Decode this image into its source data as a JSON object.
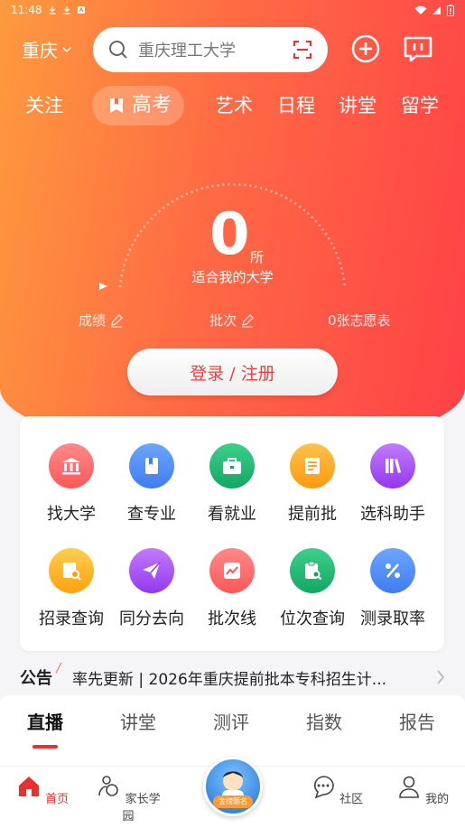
{
  "status": {
    "time": "11:48",
    "battery_icon": "battery-icon"
  },
  "header": {
    "city": "重庆",
    "search_placeholder": "重庆理工大学"
  },
  "tabs": [
    {
      "label": "关注"
    },
    {
      "label": "高考",
      "active": true
    },
    {
      "label": "艺术"
    },
    {
      "label": "日程"
    },
    {
      "label": "讲堂"
    },
    {
      "label": "留学"
    }
  ],
  "gauge": {
    "count": "0",
    "unit": "所",
    "label": "适合我的大学",
    "level": 0
  },
  "stats": {
    "score": "成绩",
    "batch": "批次",
    "wish": "0张志愿表"
  },
  "login_label": "登录 / 注册",
  "tools": [
    {
      "label": "找大学",
      "icon": "university-icon",
      "color": "#ff6b6b"
    },
    {
      "label": "查专业",
      "icon": "book-icon",
      "color": "#4f8ff7"
    },
    {
      "label": "看就业",
      "icon": "briefcase-icon",
      "color": "#1db471"
    },
    {
      "label": "提前批",
      "icon": "document-icon",
      "color": "#ffa51f"
    },
    {
      "label": "选科助手",
      "icon": "books-icon",
      "color": "#a24bf0"
    },
    {
      "label": "招录查询",
      "icon": "search-doc-icon",
      "color": "#ffb21f"
    },
    {
      "label": "同分去向",
      "icon": "paper-plane-icon",
      "color": "#a34bf0"
    },
    {
      "label": "批次线",
      "icon": "line-chart-icon",
      "color": "#ff5d5d"
    },
    {
      "label": "位次查询",
      "icon": "clipboard-search-icon",
      "color": "#1db471"
    },
    {
      "label": "测录取率",
      "icon": "percent-icon",
      "color": "#4f8ff7"
    }
  ],
  "notice": {
    "tag": "公告",
    "text": "率先更新 | 2026年重庆提前批本专科招生计..."
  },
  "content_tabs": [
    {
      "label": "直播",
      "active": true
    },
    {
      "label": "讲堂"
    },
    {
      "label": "测评"
    },
    {
      "label": "指数"
    },
    {
      "label": "报告"
    }
  ],
  "bottom_nav": [
    {
      "label": "首页",
      "active": true
    },
    {
      "label": "家长学园"
    },
    {
      "label": "金榜题名"
    },
    {
      "label": "社区"
    },
    {
      "label": "我的"
    }
  ]
}
